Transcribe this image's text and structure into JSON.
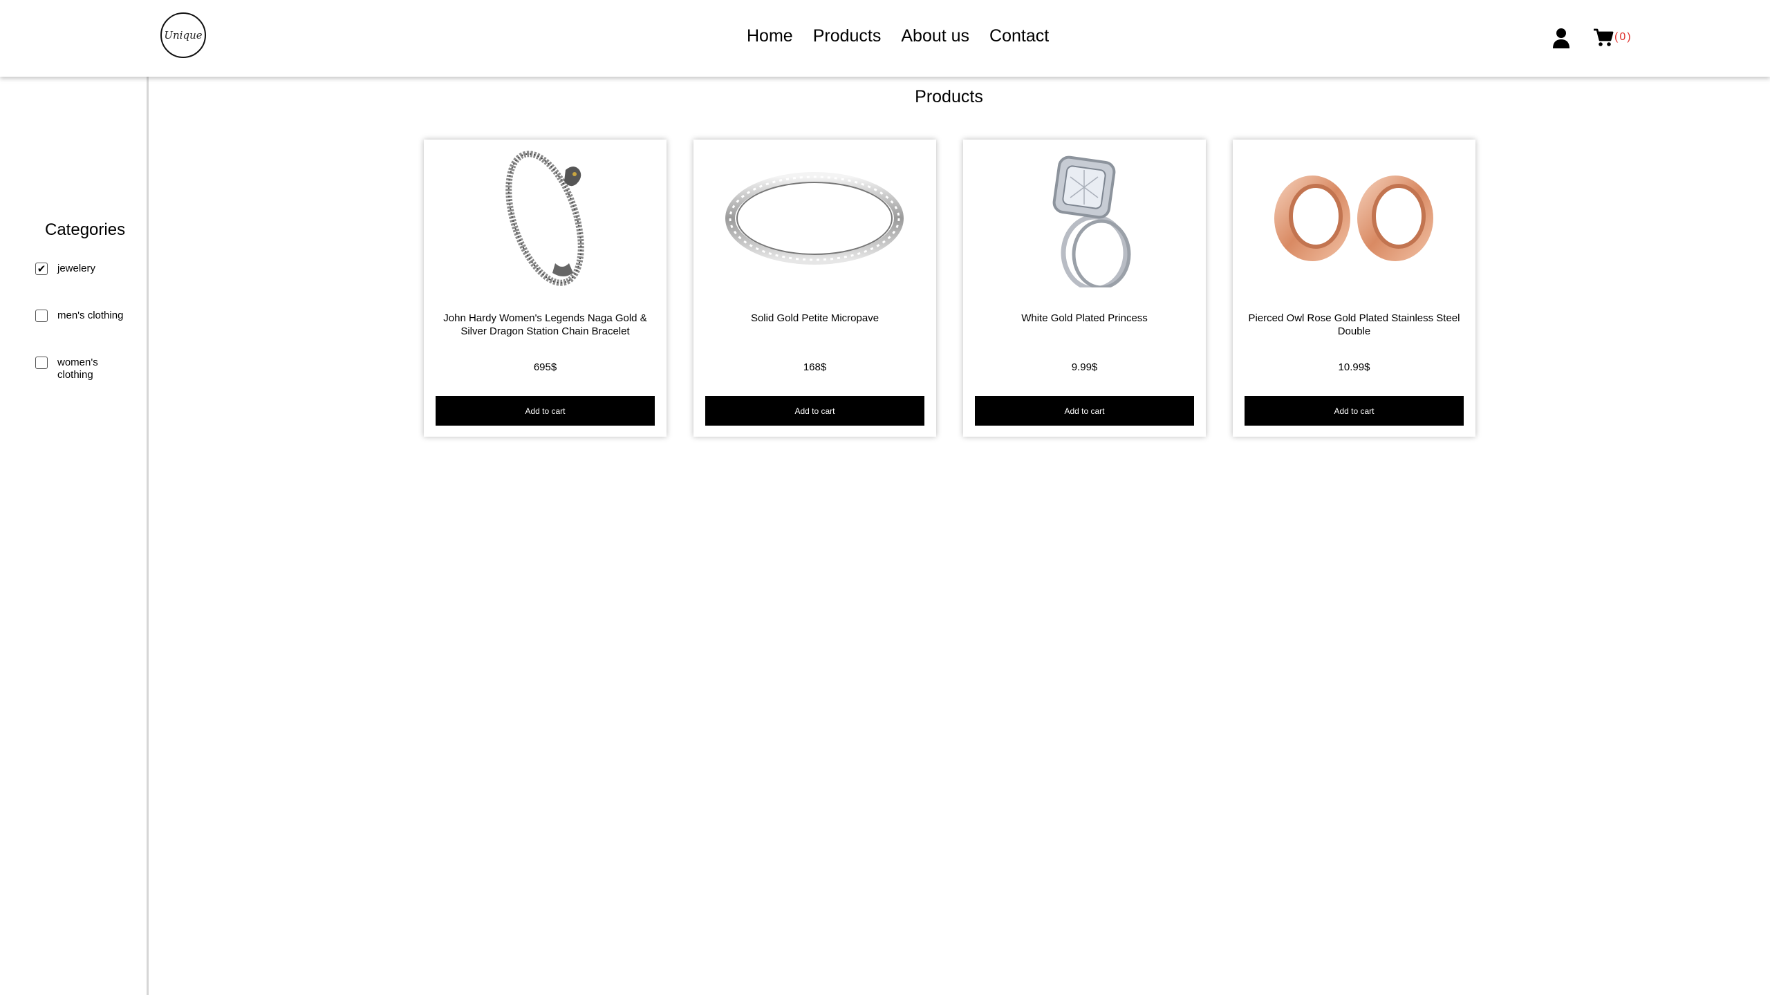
{
  "header": {
    "logo_text": "Unique",
    "nav": [
      "Home",
      "Products",
      "About us",
      "Contact"
    ],
    "cart_count": "(0)"
  },
  "sidebar": {
    "title": "Categories",
    "categories": [
      {
        "label": "jewelery",
        "checked": true
      },
      {
        "label": "men's clothing",
        "checked": false
      },
      {
        "label": "women's clothing",
        "checked": false
      }
    ]
  },
  "main": {
    "title": "Products",
    "products": [
      {
        "name": "John Hardy Women's Legends Naga Gold & Silver Dragon Station Chain Bracelet",
        "price": "695$",
        "button": "Add to cart",
        "image": "bracelet"
      },
      {
        "name": "Solid Gold Petite Micropave",
        "price": "168$",
        "button": "Add to cart",
        "image": "silver-band-ring"
      },
      {
        "name": "White Gold Plated Princess",
        "price": "9.99$",
        "button": "Add to cart",
        "image": "diamond-ring"
      },
      {
        "name": "Pierced Owl Rose Gold Plated Stainless Steel Double",
        "price": "10.99$",
        "button": "Add to cart",
        "image": "rose-gold-tunnels"
      }
    ]
  },
  "colors": {
    "accent": "#e0332f",
    "button": "#000000"
  }
}
